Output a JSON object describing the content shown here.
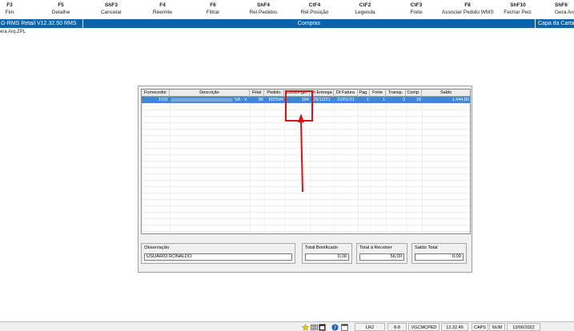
{
  "toolbar": {
    "keys": [
      {
        "key": "F3",
        "label": "Fim"
      },
      {
        "key": "F5",
        "label": "Detalhe"
      },
      {
        "key": "ShF3",
        "label": "Cancelar"
      },
      {
        "key": "F4",
        "label": "Reemite"
      },
      {
        "key": "F6",
        "label": "Filtrar"
      },
      {
        "key": "ShF4",
        "label": "Rel.Pedidos"
      },
      {
        "key": "CtF4",
        "label": "Rel.Posição"
      },
      {
        "key": "CtF2",
        "label": "Legenda"
      },
      {
        "key": "CtF3",
        "label": "Frete"
      },
      {
        "key": "F8",
        "label": "Associar Pedido WMS"
      },
      {
        "key": "ShF10",
        "label": "Fechar Ped."
      },
      {
        "key": "ShF6",
        "label": "Gera Arq"
      }
    ]
  },
  "titlebar": {
    "app": "G-RMS Retail V12.32.50 RMS",
    "center": "Compras",
    "right": "Capa da Carta"
  },
  "subtitle": "era Arq.ZPL",
  "grid": {
    "columns": [
      "Fornecedor",
      "Descrição",
      "Filial",
      "Pedido",
      "Cond.Pgto",
      "Dt Entrega",
      "Dt Fatura",
      "Pag.",
      "Frete",
      "Transp.",
      "Comp.",
      "Saldo"
    ],
    "row": {
      "fornecedor": "1031",
      "descricao_suffix": "SA - V",
      "filial": "86",
      "pedido": "602544",
      "cond_pgto": "164",
      "dt_entrega": "28/12/21",
      "dt_fatura": "21/01/21",
      "pag": "1",
      "frete": "1",
      "transp": "0",
      "comp": "16",
      "saldo": "1.444,80"
    }
  },
  "observacao": {
    "label": "Observação",
    "value": "USUARIO RONALDO"
  },
  "totals": {
    "bonificado": {
      "label": "Total Bonificado",
      "value": "0,00"
    },
    "receber": {
      "label": "Total à Receber",
      "value": "56,00"
    },
    "saldo": {
      "label": "Saldo Total",
      "value": "0,00"
    }
  },
  "statusbar": {
    "cells": [
      "LR2",
      "8-8",
      "VGCMCPED",
      "12.32.49",
      "CAPS",
      "NUM",
      "13/06/2022"
    ]
  },
  "colors": {
    "title_blue": "#0a64ad",
    "selected_row": "#3f87d8",
    "highlight_red": "#e01010"
  }
}
